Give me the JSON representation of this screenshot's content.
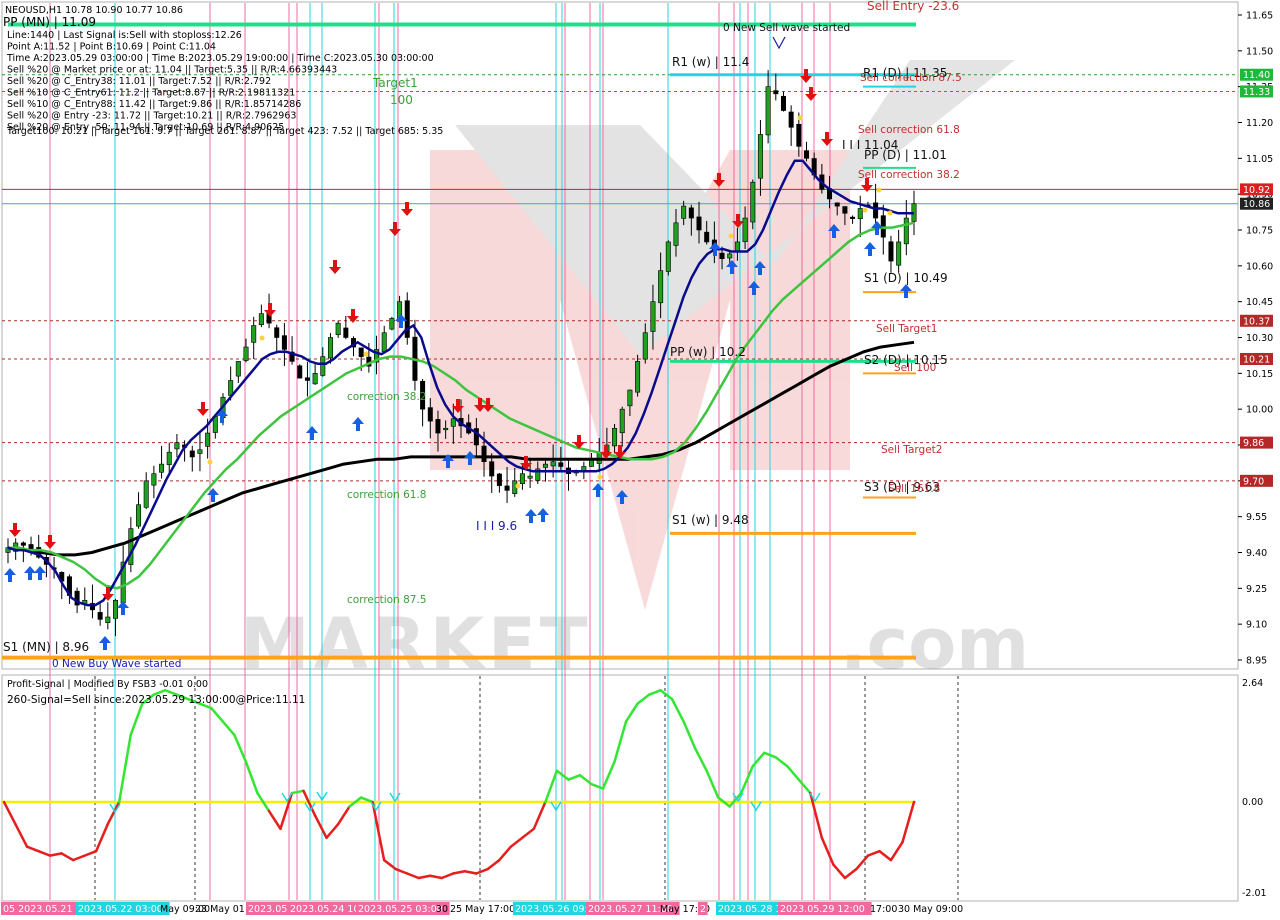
{
  "header": {
    "symbol_line": "NEOUSD,H1  10.78 10.90 10.77 10.86",
    "lines": [
      "PP (MN) | 11.09",
      "Line:1440 | Last Signal is:Sell with stoploss:12.26",
      "Point A:11.52 | Point B:10.69 | Point C:11.04",
      "Time A:2023.05.29 03:00:00 | Time B:2023.05.29 19:00:00 | Time C:2023.05.30 03:00:00",
      "Sell %20 @ Market price or at: 11.04 || Target:5.35 || R/R:4.66393443",
      "Sell %20 @ C_Entry38: 11.01 || Target:7.52 || R/R:2.792",
      "Sell %10 @ C_Entry61: 11.2 || Target:8.87 || R/R:2.19811321",
      "Sell %10 @ C_Entry88: 11.42 || Target:9.86 || R/R:1.85714286",
      "Sell %20 @ Entry -23: 11.72 || Target:10.21 || R/R:2.7962963",
      "Sell %20 @ Entry -50: 11.94 || Target:10.69 || R/R:4.90625",
      "Target100: 10.21 || Target 161: 9.7 || Target 261: 8.87 || Target 423: 7.52 || Target 685: 5.35"
    ]
  },
  "annotations": {
    "sell_entry": "Sell Entry -23.6",
    "new_sell_wave": "0 New Sell wave started",
    "new_buy_wave": "0 New Buy Wave started",
    "r1_w": "R1 (w) | 11.4",
    "r1_d": "R1 (D) | 11.35",
    "sell_corr_875": "Sell correction 87.5",
    "sell_corr_618": "Sell correction 61.8",
    "sell_corr_382": "Sell correction 38.2",
    "pp_d": "PP (D) | 11.01",
    "wave_1104": "I I I 11.04",
    "s1_d": "S1 (D) | 10.49",
    "sell_target1": "Sell Target1",
    "pp_w": "PP (w) | 10.2",
    "s2_d": "S2 (D) | 10.15",
    "sell_100": "Sell 100",
    "sell_target2": "Sell Target2",
    "s3_d": "S3 (D) | 9.63",
    "sell_1618": "Sell 161.8",
    "s1_w": "S1 (w) | 9.48",
    "wave_96": "I I I 9.6",
    "s1_mn": "S1 (MN) | 8.96",
    "target1": "Target1",
    "target1_val": "100",
    "corr_382": "correction 38.2",
    "corr_618": "correction 61.8",
    "corr_875": "correction 87.5"
  },
  "price_axis": {
    "ticks": [
      "11.65",
      "11.50",
      "11.35",
      "11.20",
      "11.05",
      "10.90",
      "10.75",
      "10.60",
      "10.45",
      "10.30",
      "10.15",
      "10.00",
      "9.85",
      "9.70",
      "9.55",
      "9.40",
      "9.25",
      "9.10",
      "8.95"
    ],
    "badges": [
      {
        "text": "11.40",
        "color": "#1fb83a"
      },
      {
        "text": "11.33",
        "color": "#1fb83a"
      },
      {
        "text": "10.92",
        "color": "#d91f1f"
      },
      {
        "text": "10.86",
        "color": "#222222"
      },
      {
        "text": "10.37",
        "color": "#b42828"
      },
      {
        "text": "10.21",
        "color": "#b42828"
      },
      {
        "text": "9.86",
        "color": "#b42828"
      },
      {
        "text": "9.70",
        "color": "#b42828"
      }
    ]
  },
  "indicator": {
    "title": "Profit-Signal | Modified By FSB3 -0.01 0.00",
    "signal": "260-Signal=Sell since:2023.05.29 13:00:00@Price:11.11",
    "axis": [
      "2.64",
      "0.00",
      "-2.01"
    ]
  },
  "time_axis": {
    "labels": [
      "05 2023.05.21 13",
      "2023.05.22 03:00",
      "May 09:00",
      "23 May 01:00",
      "2023.05",
      "2023.05.24 10:00",
      "2023.05.25 03:00",
      "30",
      "25 May 17:00",
      "2023.05.26 09:00",
      "2023.05.27 11:00",
      "May 17:00",
      "2",
      "2023.05.28 1",
      "2023.05.29 12:00",
      "17:00",
      "30 May 09:00"
    ],
    "highlighted": [
      0,
      1,
      4,
      5,
      6,
      9,
      10,
      12,
      13,
      14
    ]
  },
  "colors": {
    "bull": "#1fa01f",
    "bear": "#000000",
    "blue_ma": "#0a0a8c",
    "green_ma": "#3ec43e",
    "black_ma": "#000000",
    "cyan": "#21d6e0",
    "magenta": "#f06aa0",
    "orange": "#ffa31a",
    "teal": "#1fe08a",
    "red": "#e01010",
    "yellow_line": "#f0f000",
    "osc_green": "#32e632",
    "osc_red": "#e61e1e"
  },
  "chart_data": {
    "type": "candlestick",
    "symbol": "NEOUSD",
    "timeframe": "H1",
    "ylim": [
      8.93,
      11.69
    ],
    "ohlc_last": {
      "open": 10.78,
      "high": 10.9,
      "low": 10.77,
      "close": 10.86
    },
    "close_series": [
      9.42,
      9.44,
      9.43,
      9.41,
      9.38,
      9.35,
      9.33,
      9.28,
      9.22,
      9.18,
      9.2,
      9.16,
      9.12,
      9.13,
      9.2,
      9.36,
      9.5,
      9.6,
      9.7,
      9.73,
      9.77,
      9.82,
      9.86,
      9.84,
      9.8,
      9.83,
      9.9,
      9.97,
      10.05,
      10.12,
      10.2,
      10.26,
      10.35,
      10.4,
      10.36,
      10.3,
      10.25,
      10.2,
      10.13,
      10.12,
      10.15,
      10.22,
      10.3,
      10.36,
      10.3,
      10.26,
      10.22,
      10.18,
      10.25,
      10.32,
      10.38,
      10.45,
      10.3,
      10.12,
      10.0,
      9.95,
      9.9,
      9.92,
      9.96,
      9.93,
      9.9,
      9.85,
      9.78,
      9.72,
      9.68,
      9.66,
      9.7,
      9.73,
      9.72,
      9.75,
      9.77,
      9.78,
      9.76,
      9.73,
      9.74,
      9.76,
      9.79,
      9.82,
      9.85,
      9.92,
      10.0,
      10.08,
      10.2,
      10.32,
      10.45,
      10.58,
      10.7,
      10.78,
      10.85,
      10.8,
      10.75,
      10.7,
      10.66,
      10.63,
      10.65,
      10.7,
      10.8,
      10.95,
      11.15,
      11.35,
      11.32,
      11.25,
      11.18,
      11.1,
      11.05,
      10.98,
      10.92,
      10.88,
      10.85,
      10.82,
      10.8,
      10.84,
      10.85,
      10.8,
      10.72,
      10.62,
      10.7,
      10.8,
      10.86
    ],
    "blue_ma": [
      9.42,
      9.41,
      9.41,
      9.4,
      9.39,
      9.36,
      9.32,
      9.26,
      9.21,
      9.19,
      9.18,
      9.18,
      9.2,
      9.25,
      9.31,
      9.37,
      9.43,
      9.5,
      9.57,
      9.64,
      9.71,
      9.77,
      9.83,
      9.87,
      9.9,
      9.93,
      9.97,
      10.01,
      10.05,
      10.09,
      10.13,
      10.17,
      10.21,
      10.23,
      10.24,
      10.24,
      10.23,
      10.22,
      10.2,
      10.19,
      10.19,
      10.21,
      10.24,
      10.26,
      10.28,
      10.26,
      10.24,
      10.23,
      10.25,
      10.29,
      10.33,
      10.35,
      10.3,
      10.19,
      10.09,
      10.02,
      9.97,
      9.94,
      9.92,
      9.9,
      9.87,
      9.84,
      9.81,
      9.78,
      9.76,
      9.75,
      9.74,
      9.74,
      9.74,
      9.74,
      9.74,
      9.74,
      9.74,
      9.74,
      9.74,
      9.75,
      9.77,
      9.8,
      9.84,
      9.9,
      9.98,
      10.07,
      10.17,
      10.27,
      10.37,
      10.47,
      10.55,
      10.61,
      10.65,
      10.67,
      10.67,
      10.66,
      10.66,
      10.66,
      10.69,
      10.75,
      10.83,
      10.91,
      10.98,
      11.04,
      11.04,
      11.0,
      10.96,
      10.93,
      10.91,
      10.89,
      10.87,
      10.86,
      10.85,
      10.84,
      10.84,
      10.83,
      10.82,
      10.82,
      10.82
    ],
    "green_ma": [
      9.42,
      9.42,
      9.41,
      9.41,
      9.4,
      9.38,
      9.36,
      9.33,
      9.29,
      9.26,
      9.25,
      9.27,
      9.3,
      9.35,
      9.41,
      9.47,
      9.53,
      9.59,
      9.65,
      9.7,
      9.75,
      9.79,
      9.84,
      9.89,
      9.93,
      9.97,
      10.0,
      10.03,
      10.06,
      10.09,
      10.12,
      10.15,
      10.17,
      10.19,
      10.21,
      10.22,
      10.22,
      10.21,
      10.2,
      10.18,
      10.15,
      10.12,
      10.08,
      10.05,
      10.02,
      9.99,
      9.96,
      9.94,
      9.92,
      9.9,
      9.88,
      9.86,
      9.84,
      9.83,
      9.82,
      9.81,
      9.8,
      9.79,
      9.79,
      9.79,
      9.8,
      9.82,
      9.86,
      9.92,
      9.99,
      10.07,
      10.15,
      10.23,
      10.29,
      10.35,
      10.41,
      10.46,
      10.5,
      10.54,
      10.58,
      10.62,
      10.66,
      10.7,
      10.73,
      10.75,
      10.76,
      10.76,
      10.77,
      10.78
    ],
    "black_ma": [
      9.42,
      9.41,
      9.4,
      9.39,
      9.39,
      9.4,
      9.42,
      9.44,
      9.47,
      9.5,
      9.53,
      9.56,
      9.59,
      9.62,
      9.65,
      9.67,
      9.69,
      9.71,
      9.73,
      9.75,
      9.77,
      9.78,
      9.79,
      9.79,
      9.8,
      9.8,
      9.8,
      9.8,
      9.8,
      9.8,
      9.8,
      9.79,
      9.79,
      9.79,
      9.79,
      9.79,
      9.79,
      9.79,
      9.8,
      9.81,
      9.83,
      9.86,
      9.9,
      9.94,
      9.98,
      10.02,
      10.06,
      10.1,
      10.14,
      10.18,
      10.21,
      10.24,
      10.26,
      10.27,
      10.28
    ],
    "levels": [
      {
        "label": "R1 (w)",
        "value": 11.4
      },
      {
        "label": "R1 (D)",
        "value": 11.35
      },
      {
        "label": "PP (D)",
        "value": 11.01
      },
      {
        "label": "S1 (D)",
        "value": 10.49
      },
      {
        "label": "PP (w)",
        "value": 10.2
      },
      {
        "label": "S2 (D)",
        "value": 10.15
      },
      {
        "label": "S3 (D)",
        "value": 9.63
      },
      {
        "label": "S1 (w)",
        "value": 9.48
      },
      {
        "label": "S1 (MN)",
        "value": 8.96
      }
    ],
    "oscillator": {
      "ylim": [
        -2.01,
        2.64
      ],
      "values": [
        0.0,
        -0.5,
        -1.0,
        -1.1,
        -1.2,
        -1.15,
        -1.3,
        -1.2,
        -1.1,
        -0.5,
        0.0,
        1.5,
        2.2,
        2.4,
        2.5,
        2.4,
        2.3,
        2.2,
        2.1,
        1.8,
        1.5,
        0.9,
        0.2,
        -0.2,
        -0.6,
        0.2,
        0.25,
        -0.3,
        -0.8,
        -0.5,
        -0.1,
        0.1,
        0.0,
        -1.3,
        -1.5,
        -1.6,
        -1.7,
        -1.65,
        -1.7,
        -1.6,
        -1.55,
        -1.6,
        -1.5,
        -1.3,
        -1.0,
        -0.8,
        -0.6,
        0.0,
        0.7,
        0.5,
        0.6,
        0.4,
        0.3,
        0.9,
        1.8,
        2.2,
        2.4,
        2.5,
        2.3,
        1.8,
        1.2,
        0.7,
        0.1,
        -0.1,
        0.2,
        0.8,
        1.1,
        1.0,
        0.8,
        0.5,
        0.2,
        -0.8,
        -1.4,
        -1.7,
        -1.5,
        -1.2,
        -1.1,
        -1.3,
        -0.9,
        0.0
      ]
    }
  }
}
